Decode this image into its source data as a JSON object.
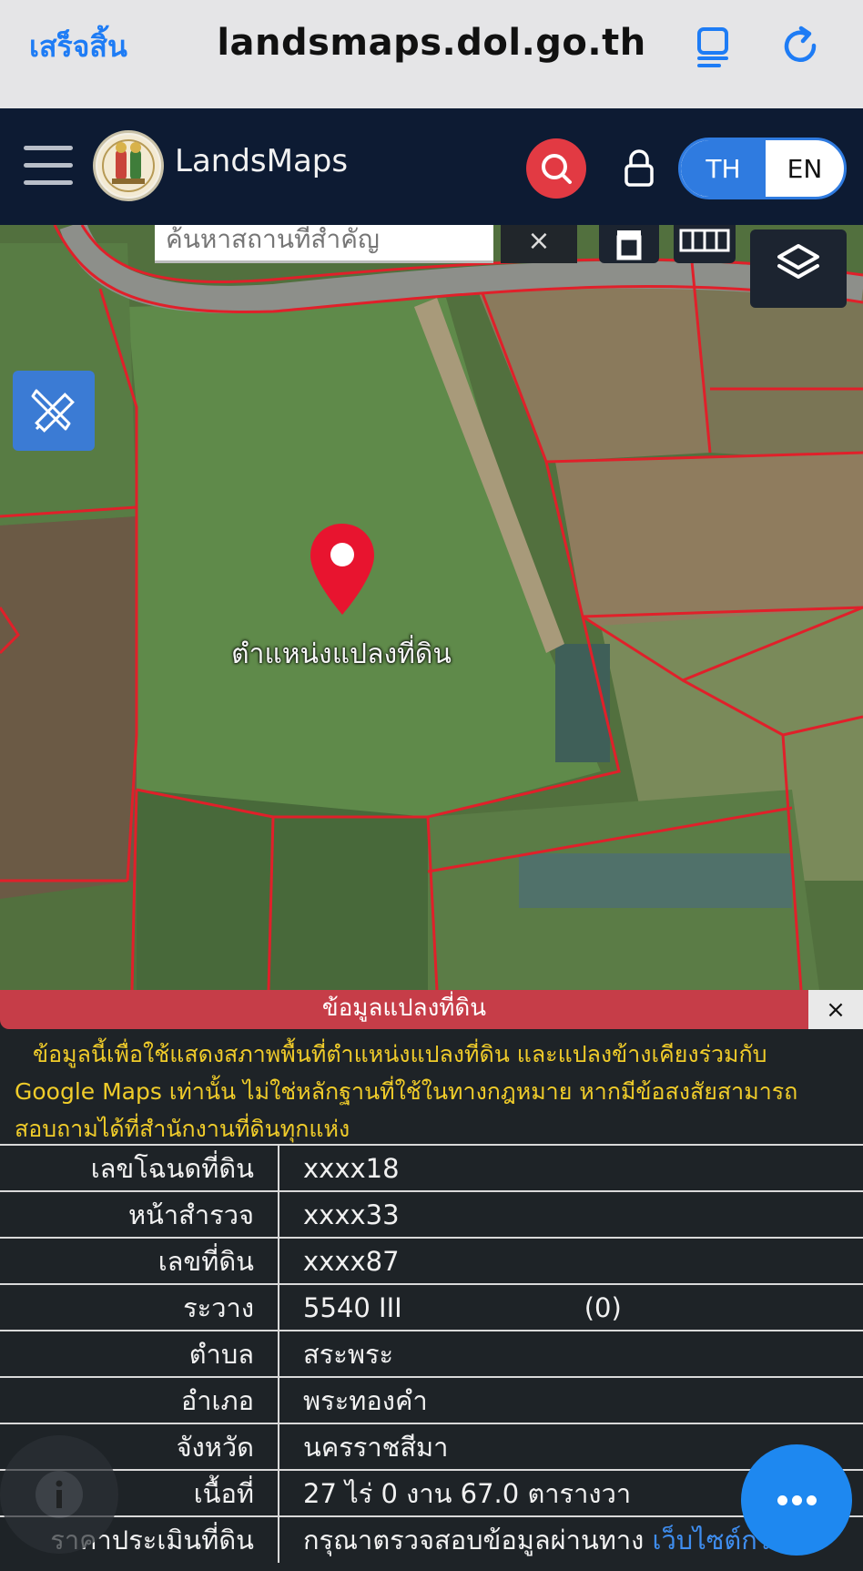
{
  "browser": {
    "done_label": "เสร็จสิ้น",
    "url": "landsmaps.dol.go.th"
  },
  "app": {
    "brand": "LandsMaps",
    "lang": {
      "th": "TH",
      "en": "EN",
      "selected": "TH"
    }
  },
  "map": {
    "search_placeholder": "ค้นหาสถานที่สำคัญ",
    "clear_label": "×",
    "pin_label": "ตำแหน่งแปลงที่ดิน"
  },
  "panel": {
    "title": "ข้อมูลแปลงที่ดิน",
    "close_label": "×",
    "disclaimer": "ข้อมูลนี้เพื่อใช้แสดงสภาพพื้นที่ตำแหน่งแปลงที่ดิน และแปลงข้างเคียงร่วมกับ Google Maps เท่านั้น ไม่ใช่หลักฐานที่ใช้ในทางกฎหมาย หากมีข้อสงสัยสามารถสอบถามได้ที่สำนักงานที่ดินทุกแห่ง",
    "rows": [
      {
        "label": "เลขโฉนดที่ดิน",
        "value": "xxxx18"
      },
      {
        "label": "หน้าสำรวจ",
        "value": "xxxx33"
      },
      {
        "label": "เลขที่ดิน",
        "value": "xxxx87"
      },
      {
        "label": "ระวาง",
        "value": "5540 III",
        "value2": "(0)"
      },
      {
        "label": "ตำบล",
        "value": "สระพระ"
      },
      {
        "label": "อำเภอ",
        "value": "พระทองคำ"
      },
      {
        "label": "จังหวัด",
        "value": "นครราชสีมา"
      },
      {
        "label": "เนื้อที่",
        "value": "27 ไร่ 0 งาน 67.0 ตารางวา"
      },
      {
        "label": "ราคาประเมินที่ดิน",
        "value": "กรุณาตรวจสอบข้อมูลผ่านทาง",
        "link": "เว็บไซต์กรม"
      }
    ]
  },
  "colors": {
    "accent": "#1e7cf5",
    "navbar": "#0d1b33",
    "panel_header": "#c63d48",
    "disclaimer": "#f0cc2a",
    "parcel_line": "#e0202a"
  }
}
